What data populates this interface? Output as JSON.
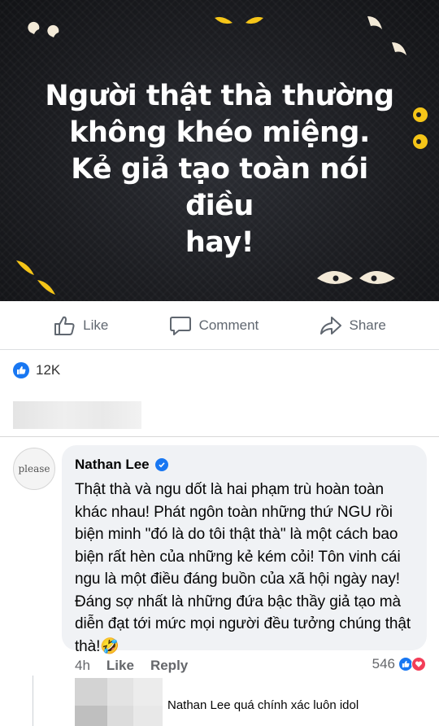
{
  "banner": {
    "lines": [
      "Người thật thà thường",
      "không khéo miệng.",
      "Kẻ giả tạo toàn nói điều",
      "hay!"
    ]
  },
  "actions": {
    "like": "Like",
    "comment": "Comment",
    "share": "Share"
  },
  "reactions": {
    "count": "12K"
  },
  "comment": {
    "author": "Nathan Lee",
    "avatar_text": "please",
    "text": "Thật thà và ngu dốt là hai phạm trù hoàn toàn khác nhau! Phát ngôn toàn những thứ NGU rồi biện minh \"đó là do tôi thật thà\" là một cách bao biện rất hèn của những kẻ kém cỏi! Tôn vinh cái ngu là một điều đáng buồn của xã hội ngày nay! Đáng sợ nhất là những đứa bậc thầy giả tạo mà diễn đạt tới mức mọi người đều tưởng chúng thật thà!🤣",
    "time": "4h",
    "like": "Like",
    "reply": "Reply",
    "reaction_count": "546"
  },
  "reply": {
    "text": "Nathan Lee quá chính xác luôn idol"
  },
  "colors": {
    "facebook_blue": "#1877f2",
    "love_red": "#f33e58",
    "bubble_bg": "#f0f2f5"
  }
}
